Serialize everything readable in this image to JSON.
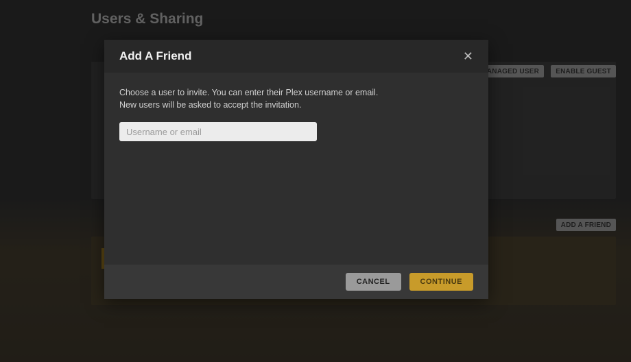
{
  "page": {
    "title": "Users & Sharing",
    "buttons": {
      "managed_user": "MANAGED USER",
      "enable_guest": "ENABLE GUEST",
      "add_friend": "ADD A FRIEND"
    }
  },
  "modal": {
    "title": "Add A Friend",
    "description_line1": "Choose a user to invite. You can enter their Plex username or email.",
    "description_line2": "New users will be asked to accept the invitation.",
    "input": {
      "placeholder": "Username or email",
      "value": ""
    },
    "buttons": {
      "cancel": "CANCEL",
      "continue": "CONTINUE"
    }
  }
}
